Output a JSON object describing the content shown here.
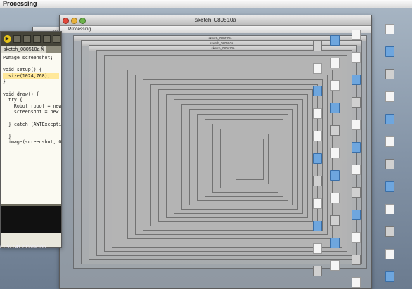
{
  "menubar": {
    "app_name": "Processing"
  },
  "main_window": {
    "title": "sketch_080510a",
    "browser_toolbar_label": "Processing"
  },
  "editor_window": {
    "title_partial": "sk",
    "tab_label": "sketch_080510a §",
    "code_lines": [
      "PImage screenshot;",
      "",
      "void setup() {",
      "  size(1024,768);",
      "}",
      "",
      "void draw() {",
      "  try {",
      "    Robot robot = new Ro",
      "    screenshot = new PIm",
      "",
      "  } catch (AWTException",
      "",
      "  }",
      "  image(screenshot, 0,"
    ],
    "bottom_status": "r 1.52.041 2 Collection"
  },
  "nested_windows": {
    "title_1": "sketch_080510a",
    "toolbar_1": "Processing",
    "title_2": "sketch_080510a",
    "title_3": "sketch_080510a"
  }
}
